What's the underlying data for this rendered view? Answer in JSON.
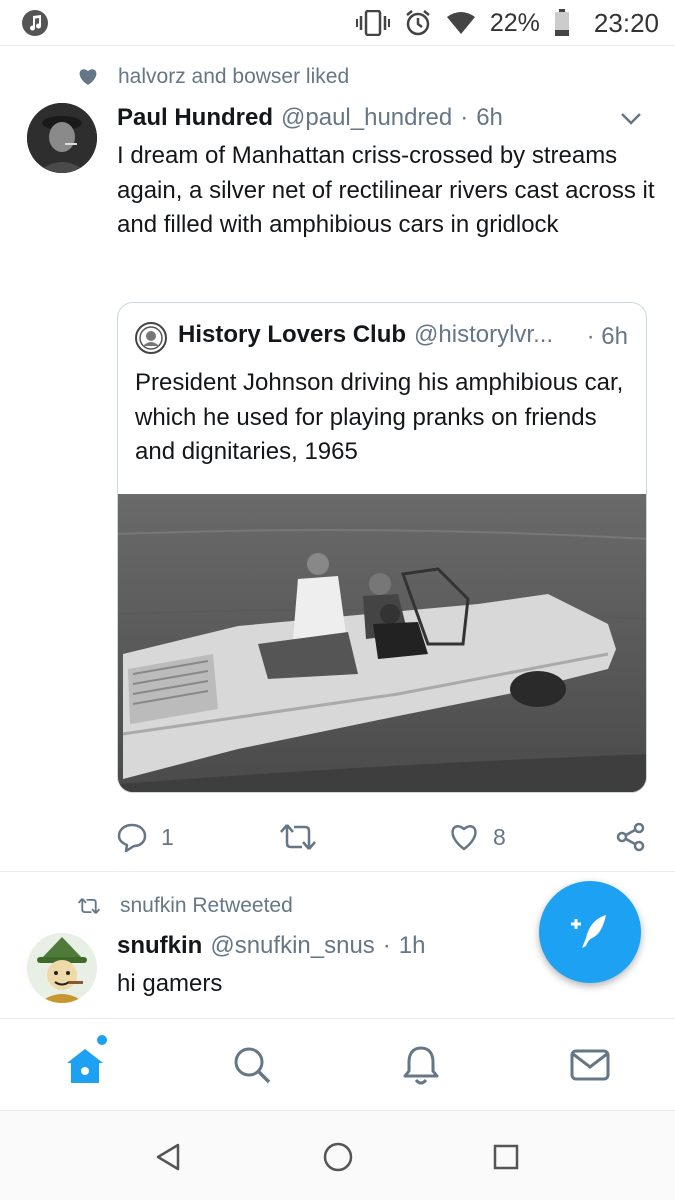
{
  "status_bar": {
    "battery": "22%",
    "time": "23:20",
    "icons": [
      "music-note-icon",
      "vibrate-icon",
      "alarm-icon",
      "wifi-icon",
      "battery-icon"
    ]
  },
  "tweet1": {
    "social_context": "halvorz and bowser liked",
    "author_name": "Paul Hundred",
    "handle": "@paul_hundred",
    "separator": "·",
    "time": "6h",
    "text": "I dream of Manhattan criss-crossed by streams again, a silver net of rectilinear rivers cast across it and filled with amphibious cars in gridlock",
    "quote": {
      "author_name": "History Lovers Club",
      "handle": "@historylvr...",
      "separator": "·",
      "time": "6h",
      "text": "President Johnson driving his amphibious car, which he used for playing pranks on friends and dignitaries, 1965",
      "image": "black-and-white-amphibious-car-photo"
    },
    "actions": {
      "reply_count": "1",
      "retweet_count": "",
      "like_count": "8"
    }
  },
  "tweet2": {
    "social_context": "snufkin Retweeted",
    "author_name": "snufkin",
    "handle": "@snufkin_snus",
    "separator": "·",
    "time": "1h",
    "text": "hi gamers"
  },
  "colors": {
    "accent": "#1da1f2",
    "secondary_text": "#657786",
    "divider": "#e6ecf0"
  }
}
